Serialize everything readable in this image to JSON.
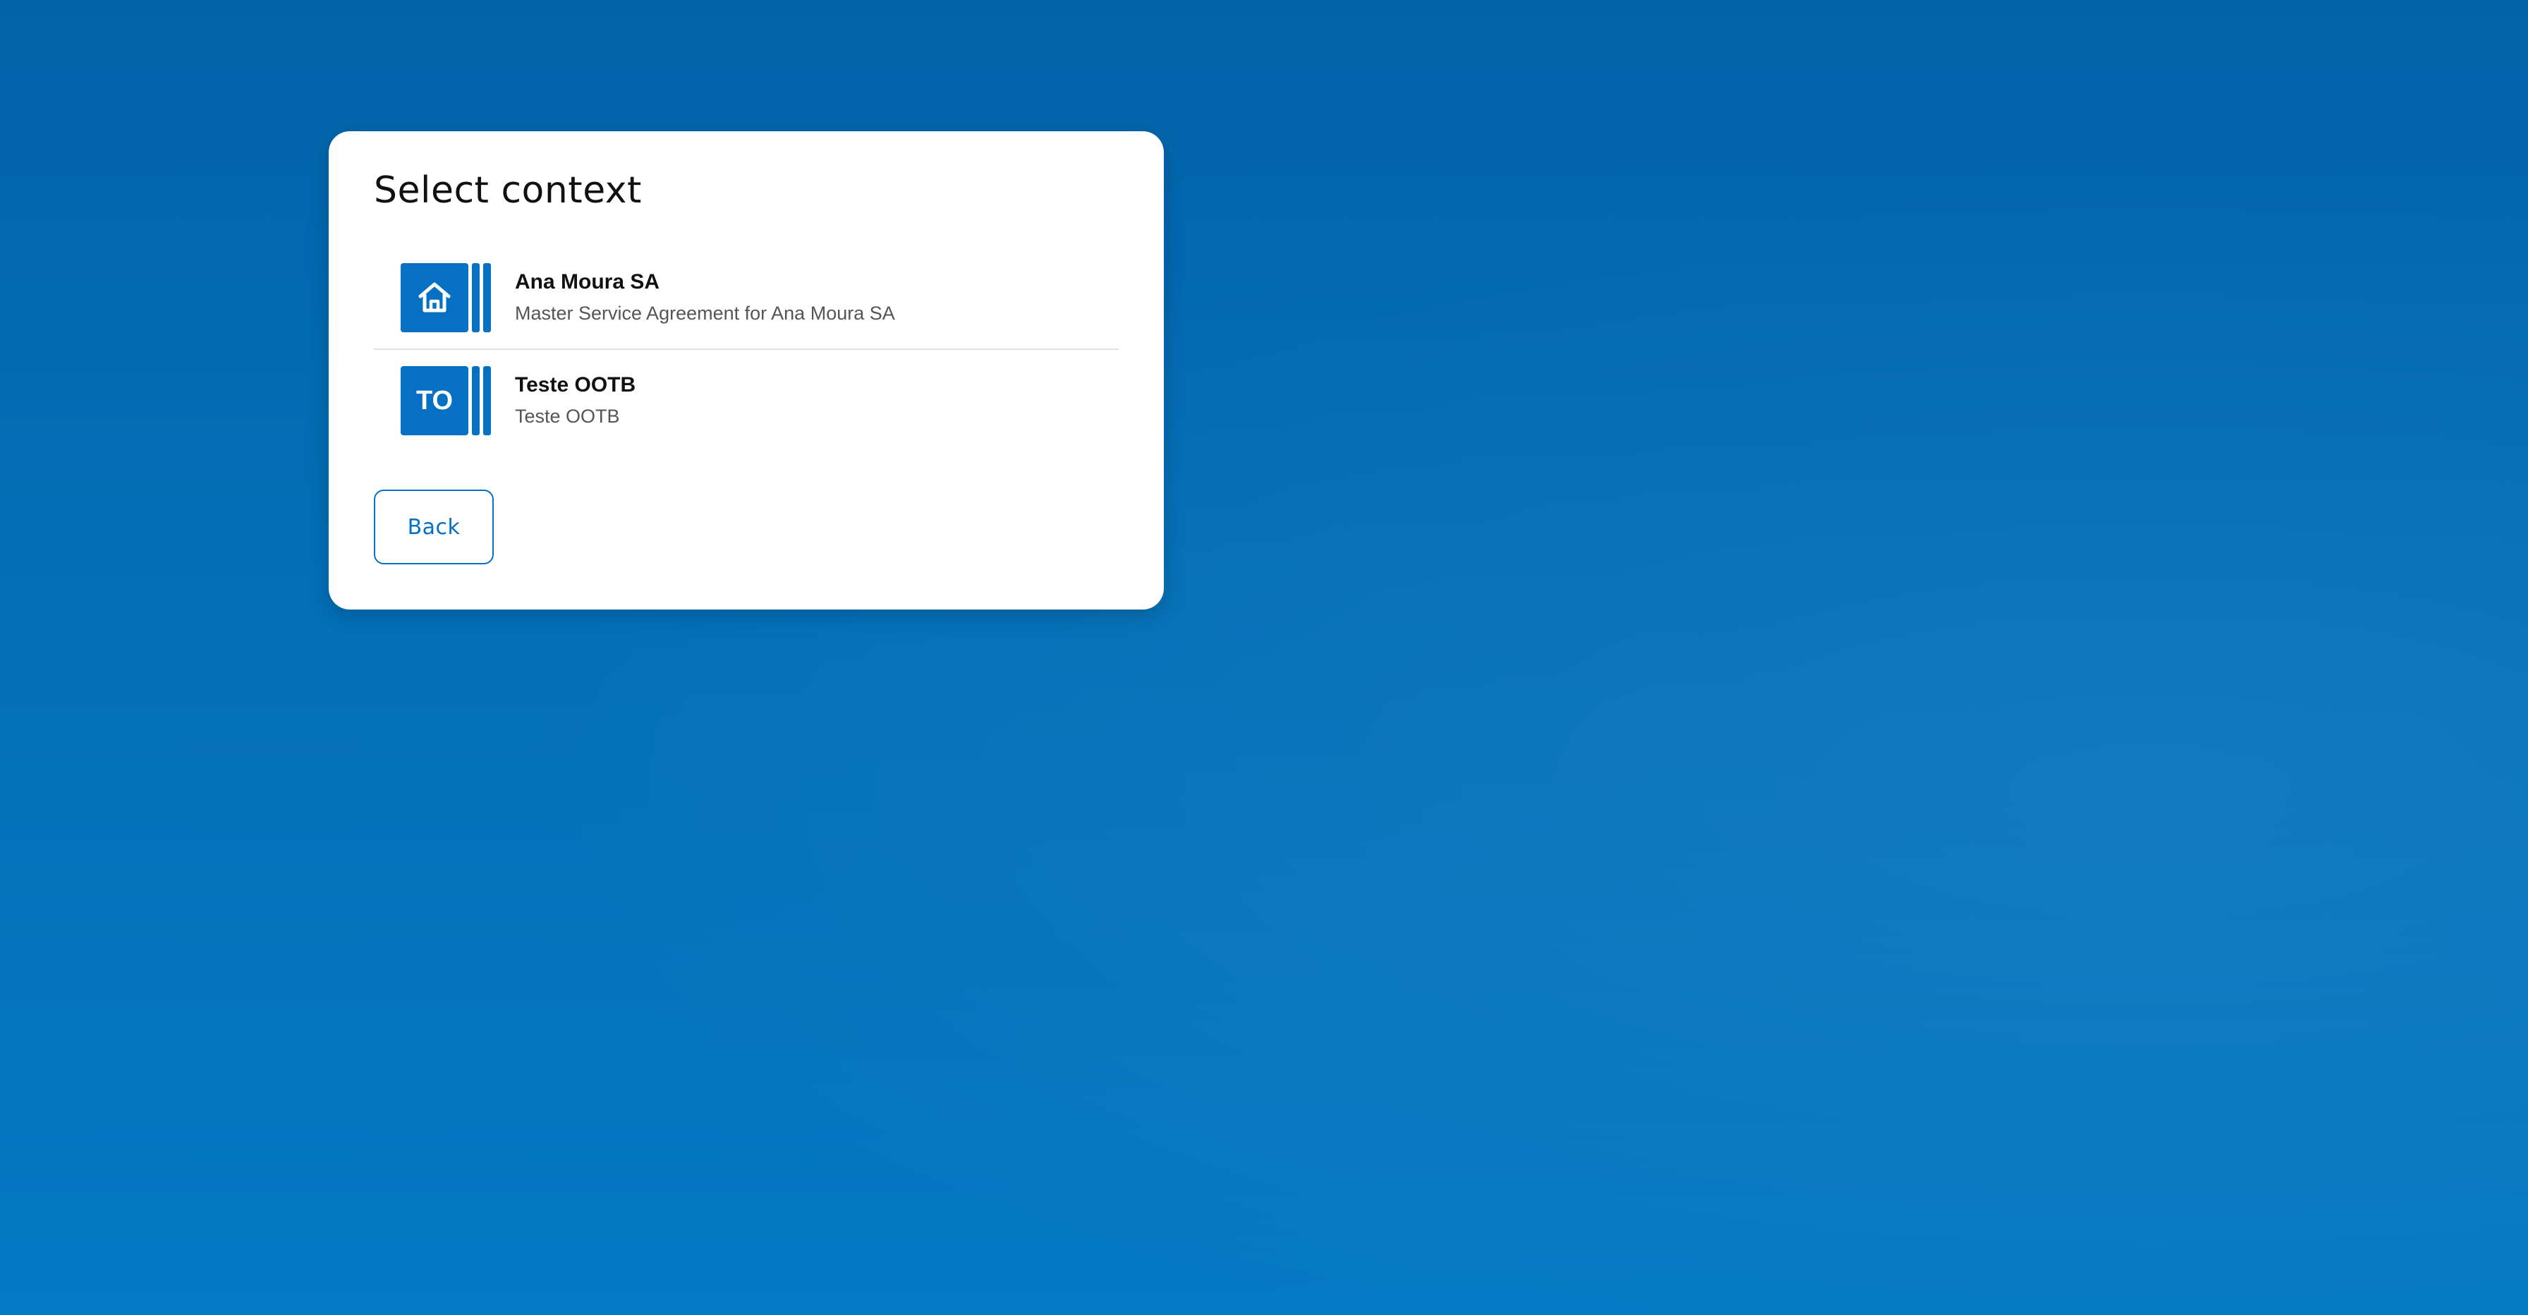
{
  "dialog": {
    "title": "Select context",
    "back_label": "Back"
  },
  "contexts": [
    {
      "title": "Ana Moura SA",
      "subtitle": "Master Service Agreement for Ana Moura SA",
      "icon": "home-icon"
    },
    {
      "title": "Teste OOTB",
      "subtitle": "Teste OOTB",
      "initials": "TO"
    }
  ],
  "colors": {
    "accent": "#0670c3",
    "background": "#036fb7",
    "card": "#ffffff"
  }
}
